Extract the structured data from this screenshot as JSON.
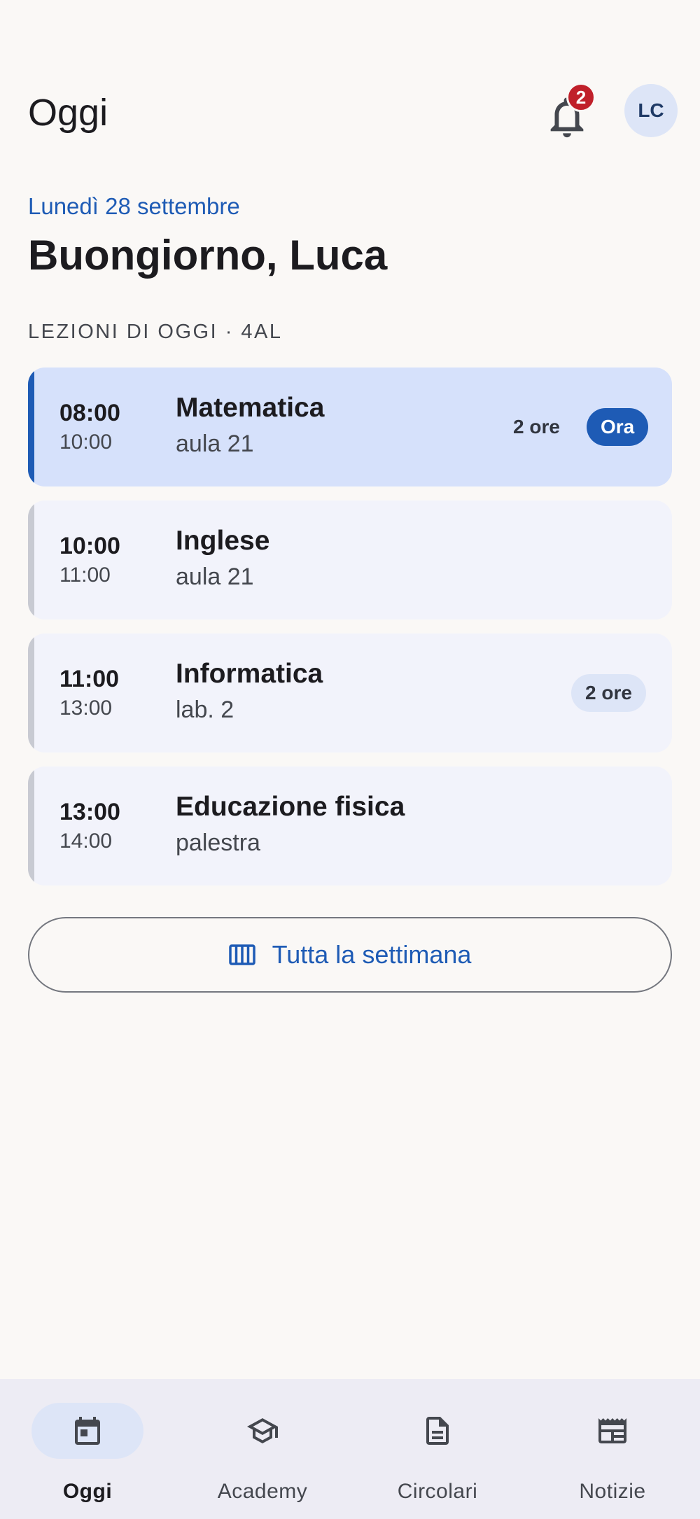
{
  "header": {
    "title": "Oggi",
    "notification_count": "2",
    "avatar_initials": "LC"
  },
  "greeting": {
    "date": "Lunedì 28 settembre",
    "text": "Buongiorno, Luca"
  },
  "section_title": "LEZIONI DI OGGI · 4AL",
  "lessons": [
    {
      "start": "08:00",
      "end": "10:00",
      "subject": "Matematica",
      "room": "aula 21",
      "duration": "2 ore",
      "status": "Ora"
    },
    {
      "start": "10:00",
      "end": "11:00",
      "subject": "Inglese",
      "room": "aula 21"
    },
    {
      "start": "11:00",
      "end": "13:00",
      "subject": "Informatica",
      "room": "lab. 2",
      "duration": "2 ore"
    },
    {
      "start": "13:00",
      "end": "14:00",
      "subject": "Educazione fisica",
      "room": "palestra"
    }
  ],
  "week_button": {
    "label": "Tutta la settimana",
    "icon": "view-week-icon"
  },
  "nav": {
    "items": [
      {
        "label": "Oggi",
        "icon": "calendar-icon",
        "selected": true
      },
      {
        "label": "Academy",
        "icon": "school-icon"
      },
      {
        "label": "Circolari",
        "icon": "document-icon"
      },
      {
        "label": "Notizie",
        "icon": "newspaper-icon"
      }
    ]
  },
  "colors": {
    "accent": "#1e5bb5",
    "badge": "#c0202a",
    "active_card": "#d6e1fb",
    "card": "#f2f3fb"
  }
}
